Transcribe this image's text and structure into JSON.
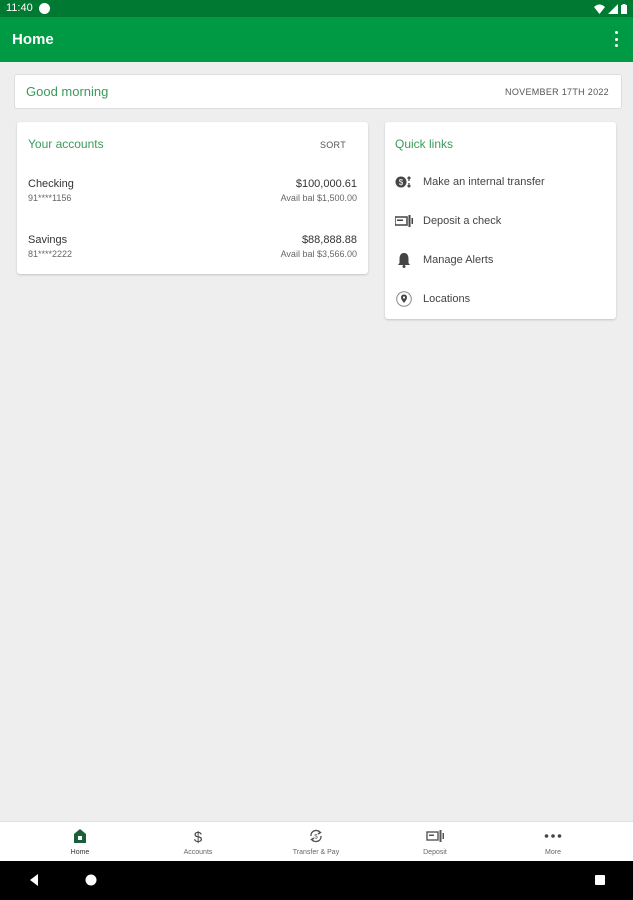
{
  "status_bar": {
    "time": "11:40",
    "g_icon": "google-g-icon",
    "icons": [
      "wifi-icon",
      "signal-icon",
      "battery-icon"
    ]
  },
  "app_bar": {
    "title": "Home",
    "menu_icon": "more-vert-icon"
  },
  "greeting_card": {
    "greeting": "Good morning",
    "date": "NOVEMBER 17TH 2022"
  },
  "accounts": {
    "title": "Your accounts",
    "sort_label": "SORT",
    "items": [
      {
        "name": "Checking",
        "number": "91****1156",
        "balance": "$100,000.61",
        "available": "Avail bal $1,500.00"
      },
      {
        "name": "Savings",
        "number": "81****2222",
        "balance": "$88,888.88",
        "available": "Avail bal $3,566.00"
      }
    ]
  },
  "quick_links": {
    "title": "Quick links",
    "items": [
      {
        "label": "Make an internal transfer",
        "icon": "transfer-icon"
      },
      {
        "label": "Deposit a check",
        "icon": "check-deposit-icon"
      },
      {
        "label": "Manage Alerts",
        "icon": "bell-icon"
      },
      {
        "label": "Locations",
        "icon": "location-pin-icon"
      }
    ]
  },
  "bottom_nav": {
    "items": [
      {
        "label": "Home",
        "icon": "home-icon",
        "active": true
      },
      {
        "label": "Accounts",
        "icon": "dollar-icon",
        "active": false
      },
      {
        "label": "Transfer & Pay",
        "icon": "transfer-pay-icon",
        "active": false
      },
      {
        "label": "Deposit",
        "icon": "deposit-icon",
        "active": false
      },
      {
        "label": "More",
        "icon": "more-horiz-icon",
        "active": false
      }
    ]
  },
  "system_nav": {
    "icons": [
      "back-icon",
      "home-circle-icon",
      "recents-icon"
    ]
  },
  "colors": {
    "primary": "#009a44",
    "status_bar": "#007a32",
    "accent_text": "#3a9b5a",
    "background": "#eeeeee",
    "active_nav_icon": "#1b5e3a"
  }
}
